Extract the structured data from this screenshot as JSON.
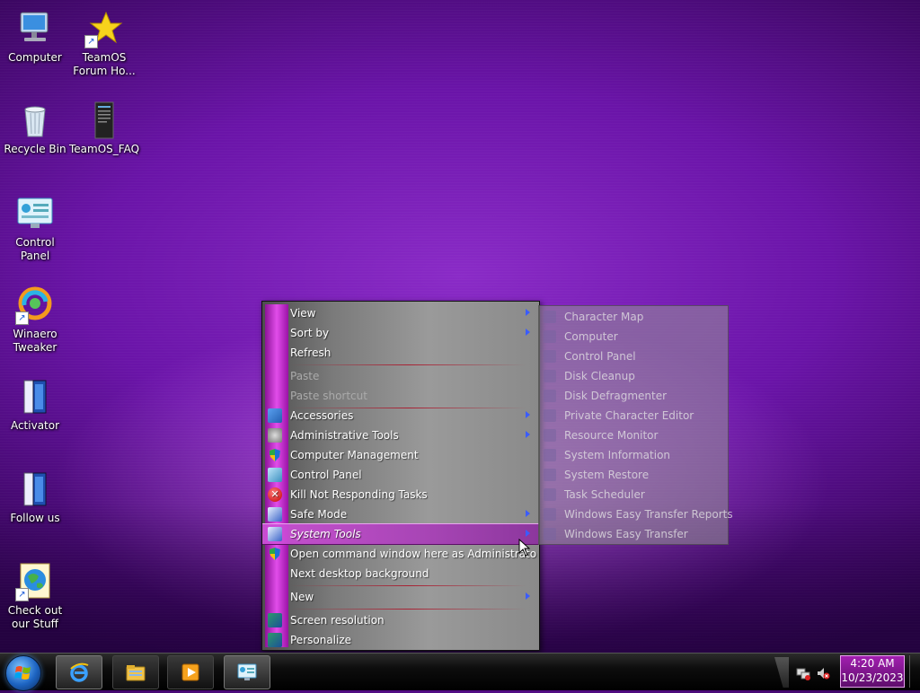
{
  "desktop": {
    "icons": [
      {
        "label": "Computer",
        "icon": "computer-icon"
      },
      {
        "label": "TeamOS Forum Ho...",
        "icon": "star-shortcut-icon"
      },
      {
        "label": "Recycle Bin",
        "icon": "recycle-bin-icon"
      },
      {
        "label": "TeamOS_FAQ",
        "icon": "document-icon"
      },
      {
        "label": "Control Panel",
        "icon": "control-panel-icon"
      },
      {
        "label": "Winaero Tweaker",
        "icon": "winaero-tweaker-icon"
      },
      {
        "label": "Activator",
        "icon": "activator-icon"
      },
      {
        "label": "Follow us",
        "icon": "follow-us-icon"
      },
      {
        "label": "Check out our Stuff",
        "icon": "globe-shortcut-icon"
      }
    ]
  },
  "context_menu": {
    "items": [
      {
        "label": "View",
        "submenu": true
      },
      {
        "label": "Sort by",
        "submenu": true
      },
      {
        "label": "Refresh"
      },
      {
        "label": "Paste",
        "disabled": true
      },
      {
        "label": "Paste shortcut",
        "disabled": true
      },
      {
        "label": "Accessories",
        "submenu": true,
        "icon": "accessories-icon"
      },
      {
        "label": "Administrative Tools",
        "submenu": true,
        "icon": "admin-tools-icon"
      },
      {
        "label": "Computer Management",
        "icon": "shield-icon"
      },
      {
        "label": "Control Panel",
        "icon": "control-panel-icon"
      },
      {
        "label": "Kill Not Responding Tasks",
        "icon": "kill-tasks-icon"
      },
      {
        "label": "Safe Mode",
        "submenu": true,
        "icon": "safe-mode-icon"
      },
      {
        "label": "System Tools",
        "submenu": true,
        "icon": "system-tools-icon",
        "highlighted": true
      },
      {
        "label": "Open command window here as Administrato",
        "icon": "shield-icon"
      },
      {
        "label": "Next desktop background"
      },
      {
        "label": "New",
        "submenu": true
      },
      {
        "label": "Screen resolution",
        "icon": "screen-resolution-icon"
      },
      {
        "label": "Personalize",
        "icon": "personalize-icon"
      }
    ]
  },
  "submenu": {
    "items": [
      "Character Map",
      "Computer",
      "Control Panel",
      "Disk Cleanup",
      "Disk Defragmenter",
      "Private Character Editor",
      "Resource Monitor",
      "System Information",
      "System Restore",
      "Task Scheduler",
      "Windows Easy Transfer Reports",
      "Windows Easy Transfer"
    ]
  },
  "taskbar": {
    "start_icon": "windows-start-orb-icon",
    "pinned": [
      "internet-explorer-icon",
      "file-explorer-icon",
      "media-player-icon",
      "control-panel-icon"
    ],
    "tray_icons": [
      "network-icon",
      "volume-muted-icon"
    ],
    "time": "4:20 AM",
    "date": "10/23/2023"
  },
  "colors": {
    "accent": "#c63ad3",
    "desktop_bg": "#6a14a8"
  }
}
